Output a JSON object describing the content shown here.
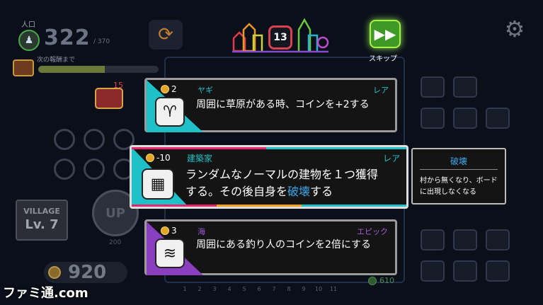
{
  "stats": {
    "population_label": "人口",
    "population": "322",
    "population_max": "/ 370",
    "reward_label": "次の報酬まで",
    "reward_progress": 0.55,
    "chest_count": "15"
  },
  "turn": {
    "number": "13",
    "skip_label": "スキップ"
  },
  "cards": [
    {
      "cost": "2",
      "name": "ヤギ",
      "rarity": "レア",
      "desc": "周囲に草原がある時、コインを+2する",
      "color": "#1fc1c8",
      "icon": "goat-icon"
    },
    {
      "cost": "-10",
      "name": "建築家",
      "rarity": "レア",
      "desc_1": "ランダムなノーマルの建物を１つ獲得",
      "desc_2": "する。その後自身を",
      "desc_keyword": "破壊",
      "desc_3": "する",
      "color": "#1fc1c8",
      "icon": "architect-icon"
    },
    {
      "cost": "3",
      "name": "海",
      "rarity": "エピック",
      "desc": "周囲にある釣り人のコインを2倍にする",
      "color": "#8a3fc0",
      "icon": "wave-icon"
    }
  ],
  "tooltip": {
    "title": "破壊",
    "body": "村から無くなり、ボードに出現しなくなる"
  },
  "village": {
    "label": "VILLAGE",
    "level": "Lv. 7",
    "up_label": "UP",
    "up_cost": "200"
  },
  "coins": {
    "total": "920",
    "side_value": "610"
  },
  "turn_progress": [
    "1",
    "2",
    "3",
    "4",
    "5",
    "6",
    "7",
    "8",
    "9",
    "10",
    "11"
  ],
  "watermark": "ファミ通.com",
  "colors": {
    "teal": "#1fc1c8",
    "purple": "#8a3fc0",
    "accent_link": "#39a7ea",
    "skip_green": "#3f9a25"
  }
}
